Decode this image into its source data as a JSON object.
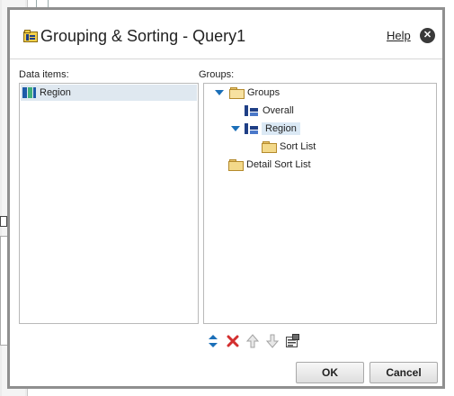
{
  "dialog": {
    "title": "Grouping & Sorting - Query1",
    "help_label": "Help",
    "close_glyph": "✕"
  },
  "data_items": {
    "label": "Data items:",
    "items": [
      {
        "label": "Region",
        "icon": "data-item-icon"
      }
    ]
  },
  "groups": {
    "label": "Groups:",
    "tree": {
      "root": "Groups",
      "overall": "Overall",
      "region": "Region",
      "sort_list": "Sort List",
      "detail_sort_list": "Detail Sort List"
    }
  },
  "toolbar": {
    "icons": [
      "expand-collapse-icon",
      "delete-icon",
      "move-up-icon",
      "move-down-icon",
      "properties-icon"
    ]
  },
  "buttons": {
    "ok": "OK",
    "cancel": "Cancel"
  },
  "colors": {
    "selection": "#dbe9f5",
    "data_item_selection": "#dfe8f0",
    "tree_toggle": "#1b6fb8",
    "delete": "#d32f2f"
  }
}
